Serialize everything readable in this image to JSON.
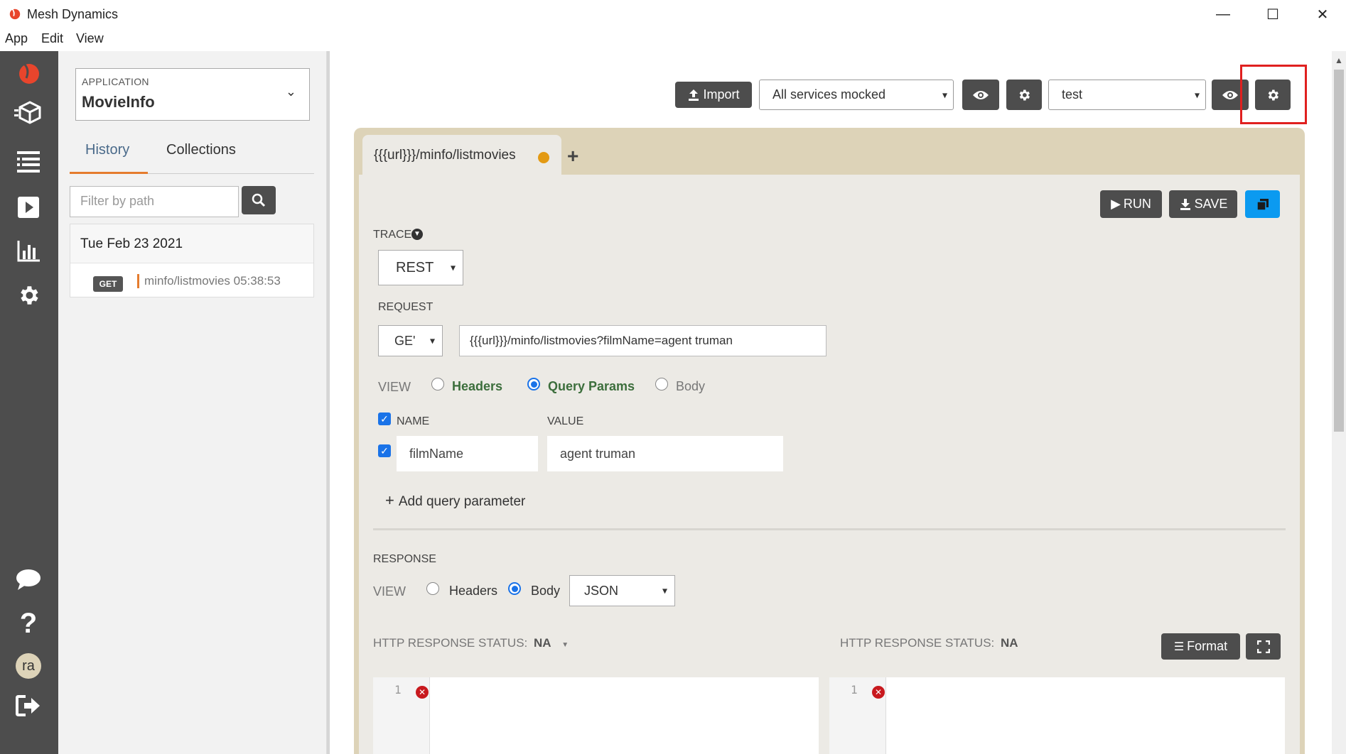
{
  "window": {
    "title": "Mesh Dynamics",
    "minimize": "—",
    "maximize": "☐",
    "close": "✕"
  },
  "menu": [
    "App",
    "Edit",
    "View"
  ],
  "sidebar_icons": [
    "logo-icon",
    "services-cube-icon",
    "list-icon",
    "play-icon",
    "bar-chart-icon",
    "gear-icon",
    "chat-icon",
    "help-icon",
    "user-avatar",
    "logout-icon"
  ],
  "avatar_initials": "ra",
  "left_panel": {
    "application_label": "APPLICATION",
    "application_value": "MovieInfo",
    "tabs": {
      "history": "History",
      "collections": "Collections"
    },
    "filter_placeholder": "Filter by path",
    "history": {
      "date": "Tue Feb 23 2021",
      "method": "GET",
      "path": "minfo/listmovies 05:38:53"
    }
  },
  "toolbar": {
    "import_label": "Import",
    "mock_select": "All services mocked",
    "env_select": "test"
  },
  "request_tab": {
    "title": "{{{url}}}/minfo/listmovies",
    "add": "+"
  },
  "actions": {
    "run": "RUN",
    "save": "SAVE"
  },
  "trace": {
    "label": "TRACE",
    "protocol": "REST"
  },
  "request": {
    "label": "REQUEST",
    "method": "GE'",
    "url": "{{{url}}}/minfo/listmovies?filmName=agent truman",
    "view_label": "VIEW",
    "view_options": {
      "headers": "Headers",
      "query_params": "Query Params",
      "body": "Body"
    },
    "params_header": {
      "name": "NAME",
      "value": "VALUE"
    },
    "params": [
      {
        "name": "filmName",
        "value": "agent truman"
      }
    ],
    "add_param": "Add query parameter"
  },
  "response": {
    "label": "RESPONSE",
    "view_label": "VIEW",
    "view_options": {
      "headers": "Headers",
      "body": "Body"
    },
    "format_select": "JSON",
    "status_left_label": "HTTP RESPONSE STATUS:",
    "status_left_value": "NA",
    "status_right_label": "HTTP RESPONSE STATUS:",
    "status_right_value": "NA",
    "format_button": "Format",
    "line_number": "1"
  },
  "colors": {
    "rail": "#4d4d4d",
    "accent_orange": "#e57c2e",
    "blue_button": "#0b9af0",
    "highlight_frame": "#e0201f",
    "request_frame": "#ddd3b8"
  }
}
